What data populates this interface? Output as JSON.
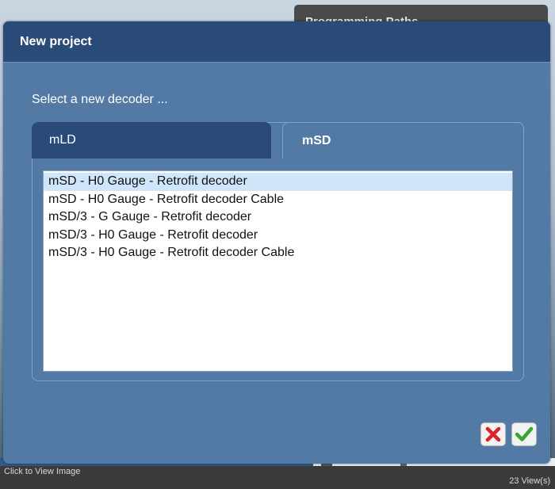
{
  "background": {
    "panel_title": "Programming Paths"
  },
  "dialog": {
    "title": "New project",
    "prompt": "Select a new decoder ...",
    "tabs": [
      {
        "label": "mLD",
        "active": false
      },
      {
        "label": "mSD",
        "active": true
      }
    ],
    "decoders": [
      {
        "label": "mSD - H0 Gauge - Retrofit decoder",
        "selected": true
      },
      {
        "label": "mSD - H0 Gauge - Retrofit decoder Cable",
        "selected": false
      },
      {
        "label": "mSD/3 - G Gauge - Retrofit decoder",
        "selected": false
      },
      {
        "label": "mSD/3 - H0 Gauge - Retrofit decoder",
        "selected": false
      },
      {
        "label": "mSD/3 - H0 Gauge - Retrofit decoder Cable",
        "selected": false
      }
    ],
    "buttons": {
      "cancel_icon": "red-x-icon",
      "ok_icon": "green-check-icon"
    }
  },
  "footer": {
    "caption": "Click to View Image",
    "views": "23 View(s)"
  },
  "colors": {
    "dialog_bg": "#537aa5",
    "header_bg": "#2a4a78",
    "selected_row": "#cfe6fa",
    "cancel_red": "#d9222a",
    "ok_green": "#3aa52f"
  }
}
